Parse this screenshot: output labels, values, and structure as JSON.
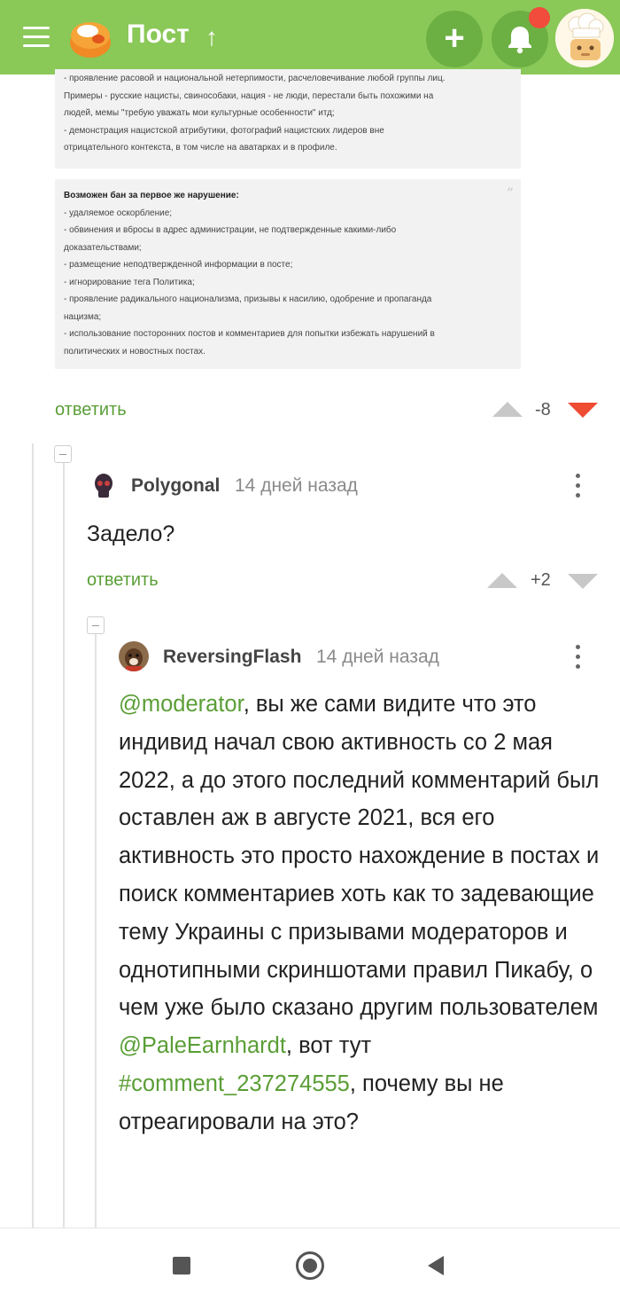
{
  "header": {
    "title": "Пост",
    "title_arrow": "↑",
    "add_label": "+",
    "has_notification_badge": true,
    "colors": {
      "bar": "#8ac858",
      "button": "#6cb043",
      "badge": "#f14c3c"
    }
  },
  "rules_image": {
    "block1_lines": [
      "- проявление расовой и национальной нетерпимости, расчеловечивание любой группы лиц.",
      "Примеры - русские нацисты, свинособаки, нация - не люди, перестали быть похожими на",
      "людей, мемы \"требую уважать мои культурные особенности\" итд;",
      "- демонстрация нацистской атрибутики, фотографий нацистских лидеров вне",
      "отрицательного контекста, в том числе на аватарках и в профиле."
    ],
    "block2_heading": "Возможен бан за первое же нарушение:",
    "block2_lines": [
      "- удаляемое оскорбление;",
      "- обвинения и вбросы в адрес администрации, не подтвержденные какими-либо",
      "доказательствами;",
      "- размещение неподтвержденной информации в посте;",
      "- игнорирование тега Политика;",
      "- проявление радикального национализма, призывы к насилию, одобрение и пропаганда",
      "нацизма;",
      "- использование посторонних постов и комментариев для попытки избежать нарушений в",
      "политических и новостных постах."
    ],
    "quote_mark": "”"
  },
  "comment0": {
    "reply_label": "ответить",
    "score": "-8",
    "downvoted": true
  },
  "comment1": {
    "author": "Polygonal",
    "time": "14 дней назад",
    "text": "Задело?",
    "reply_label": "ответить",
    "score": "+2"
  },
  "comment2": {
    "author": "ReversingFlash",
    "time": "14 дней назад",
    "mention1": "@moderator",
    "text1": ", вы же сами видите что это индивид начал свою активность со 2 мая 2022, а до этого последний комментарий был оставлен аж в августе 2021, вся его активность это просто нахождение в постах и поиск комментариев хоть как то задевающие тему Украины с призывами модераторов и однотипными скриншотами правил Пикабу, о чем уже было сказано другим пользователем ",
    "mention2": "@PaleEarnhardt",
    "text2": ", вот тут ",
    "mention3": "#comment_237274555",
    "text3": ", почему вы не отреагировали на это?"
  },
  "accent_color": "#5a9e36"
}
